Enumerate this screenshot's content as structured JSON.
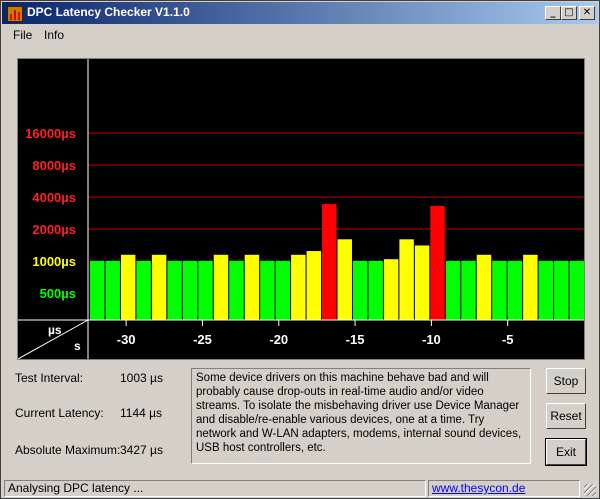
{
  "window": {
    "title": "DPC Latency Checker V1.1.0",
    "controls": {
      "minimize": "_",
      "maximize": "□",
      "close": "✕"
    }
  },
  "menu": {
    "file": "File",
    "info": "Info"
  },
  "chart_data": {
    "type": "bar",
    "y_scale": "log2",
    "y_tick_labels": [
      {
        "label": "16000µs",
        "value": 16000,
        "color": "#ff2020"
      },
      {
        "label": "8000µs",
        "value": 8000,
        "color": "#ff2020"
      },
      {
        "label": "4000µs",
        "value": 4000,
        "color": "#ff2020"
      },
      {
        "label": "2000µs",
        "value": 2000,
        "color": "#ff2020"
      },
      {
        "label": "1000µs",
        "value": 1000,
        "color": "#ffff00"
      },
      {
        "label": "500µs",
        "value": 500,
        "color": "#00ff00"
      }
    ],
    "gridlines_at": [
      16000,
      8000,
      4000,
      2000
    ],
    "corner_labels": {
      "unit_y": "µs",
      "unit_x": "s"
    },
    "x_tick_labels": [
      "-30",
      "-25",
      "-20",
      "-15",
      "-10",
      "-5"
    ],
    "x_tick_values": [
      -30,
      -25,
      -20,
      -15,
      -10,
      -5
    ],
    "x_range": [
      -32.5,
      0
    ],
    "bar_values_us": [
      1003,
      1003,
      1144,
      1003,
      1144,
      1003,
      1003,
      1003,
      1144,
      1003,
      1144,
      1003,
      1003,
      1144,
      1240,
      3427,
      1600,
      1003,
      1003,
      1040,
      1600,
      1400,
      3300,
      1003,
      1003,
      1144,
      1003,
      1003,
      1144,
      1003,
      1003,
      1003
    ],
    "color_thresholds": {
      "green_below": 1010,
      "yellow_below": 2000
    },
    "colors": {
      "green": "#00ff00",
      "yellow": "#ffff00",
      "red": "#ff0000",
      "grid": "#c00000",
      "axis": "#ffffff",
      "tick_text": "#ffffff"
    }
  },
  "stats": {
    "test_interval_label": "Test Interval:",
    "test_interval_value": "1003 µs",
    "current_latency_label": "Current Latency:",
    "current_latency_value": "1144 µs",
    "absolute_max_label": "Absolute Maximum:",
    "absolute_max_value": "3427 µs"
  },
  "info_text": "Some device drivers on this machine behave bad and will probably cause drop-outs in real-time audio and/or video streams. To isolate the misbehaving driver use Device Manager and disable/re-enable various devices, one at a time. Try network and W-LAN adapters, modems, internal sound devices, USB host controllers, etc.",
  "buttons": {
    "stop": "Stop",
    "reset": "Reset",
    "exit": "Exit"
  },
  "status": {
    "text": "Analysing DPC latency ...",
    "link": "www.thesycon.de"
  }
}
